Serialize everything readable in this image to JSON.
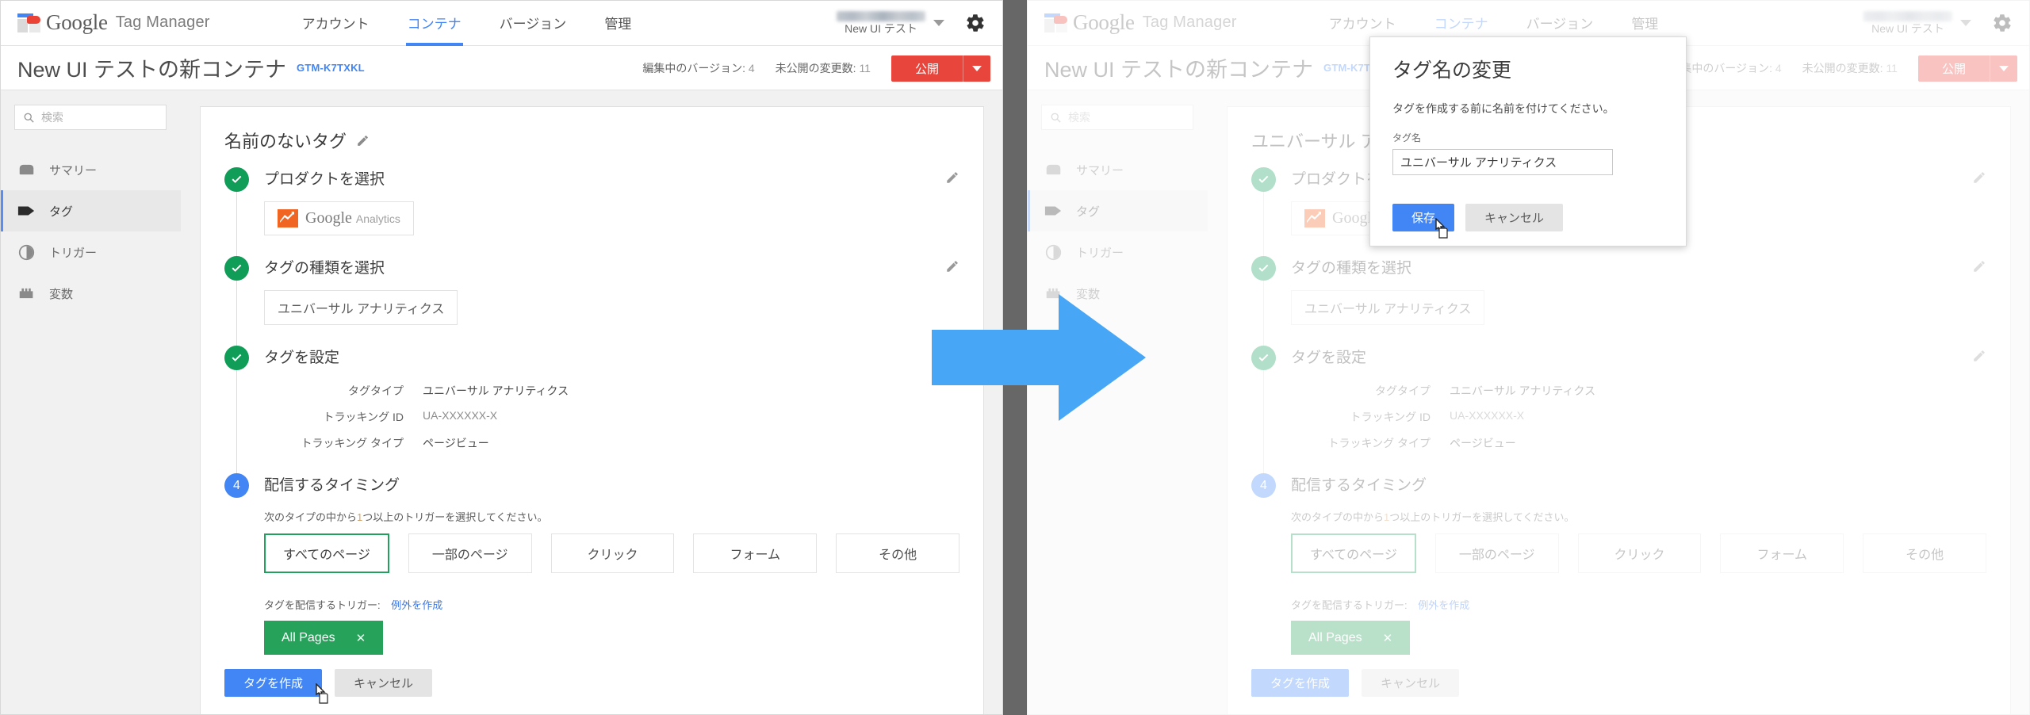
{
  "brand": {
    "logo_word": "Google",
    "logo_sub": "Tag Manager",
    "accent_blue": "#4285f4",
    "accent_green": "#0f9d58",
    "accent_red": "#e8453c",
    "arrow_blue": "#47a6f5",
    "divider_gray": "#676767"
  },
  "topnav": {
    "items": [
      {
        "label": "アカウント",
        "active": false
      },
      {
        "label": "コンテナ",
        "active": true
      },
      {
        "label": "バージョン",
        "active": false
      },
      {
        "label": "管理",
        "active": false
      }
    ],
    "account_name": "New UI テスト",
    "gear_icon": "gear-icon",
    "chevron_icon": "chevron-down-icon"
  },
  "titlebar": {
    "container_name": "New UI テストの新コンテナ",
    "container_id": "GTM-K7TXKL",
    "version_label": "編集中のバージョン:",
    "version_value": "4",
    "changes_label": "未公開の変更数:",
    "changes_value": "11",
    "publish_label": "公開",
    "publish_caret_icon": "chevron-down-icon"
  },
  "sidebar": {
    "search_placeholder": "検索",
    "search_icon": "search-icon",
    "items": [
      {
        "label": "サマリー",
        "icon": "summary-icon",
        "active": false
      },
      {
        "label": "タグ",
        "icon": "tag-icon",
        "active": true
      },
      {
        "label": "トリガー",
        "icon": "trigger-icon",
        "active": false
      },
      {
        "label": "変数",
        "icon": "variable-icon",
        "active": false
      }
    ]
  },
  "tag_editor": {
    "left_title": "名前のないタグ",
    "right_title": "ユニバーサル ア",
    "edit_icon": "pencil-icon",
    "steps": [
      {
        "head": "プロダクトを選択",
        "state": "done",
        "chip_type": "google-analytics",
        "chip_word": "Google",
        "chip_sub": "Analytics",
        "edit_icon": "pencil-icon"
      },
      {
        "head": "タグの種類を選択",
        "state": "done",
        "chip_type": "plain",
        "chip_label": "ユニバーサル アナリティクス",
        "edit_icon": "pencil-icon"
      },
      {
        "head": "タグを設定",
        "state": "done",
        "edit_icon": "pencil-icon",
        "details": [
          {
            "key": "タグタイプ",
            "value": "ユニバーサル アナリティクス",
            "muted": false
          },
          {
            "key": "トラッキング ID",
            "value": "UA-XXXXXX-X",
            "muted": true
          },
          {
            "key": "トラッキング タイプ",
            "value": "ページビュー",
            "muted": false
          }
        ]
      },
      {
        "head": "配信するタイミング",
        "state": "number",
        "number": "4",
        "hint_before": "次のタイプの中から",
        "hint_highlight": "1",
        "hint_after": "つ以上のトリガーを選択してください。",
        "trigger_types": [
          {
            "label": "すべてのページ",
            "selected": true
          },
          {
            "label": "一部のページ",
            "selected": false
          },
          {
            "label": "クリック",
            "selected": false
          },
          {
            "label": "フォーム",
            "selected": false
          },
          {
            "label": "その他",
            "selected": false
          }
        ],
        "fire_label": "タグを配信するトリガー:",
        "exception_link": "例外を作成",
        "trigger_pill": "All Pages",
        "trigger_pill_remove_icon": "close-icon"
      }
    ],
    "create_label": "タグを作成",
    "cancel_label": "キャンセル"
  },
  "modal": {
    "title": "タグ名の変更",
    "description": "タグを作成する前に名前を付けてください。",
    "field_label": "タグ名",
    "field_value": "ユニバーサル アナリティクス",
    "save_label": "保存",
    "cancel_label": "キャンセル"
  }
}
